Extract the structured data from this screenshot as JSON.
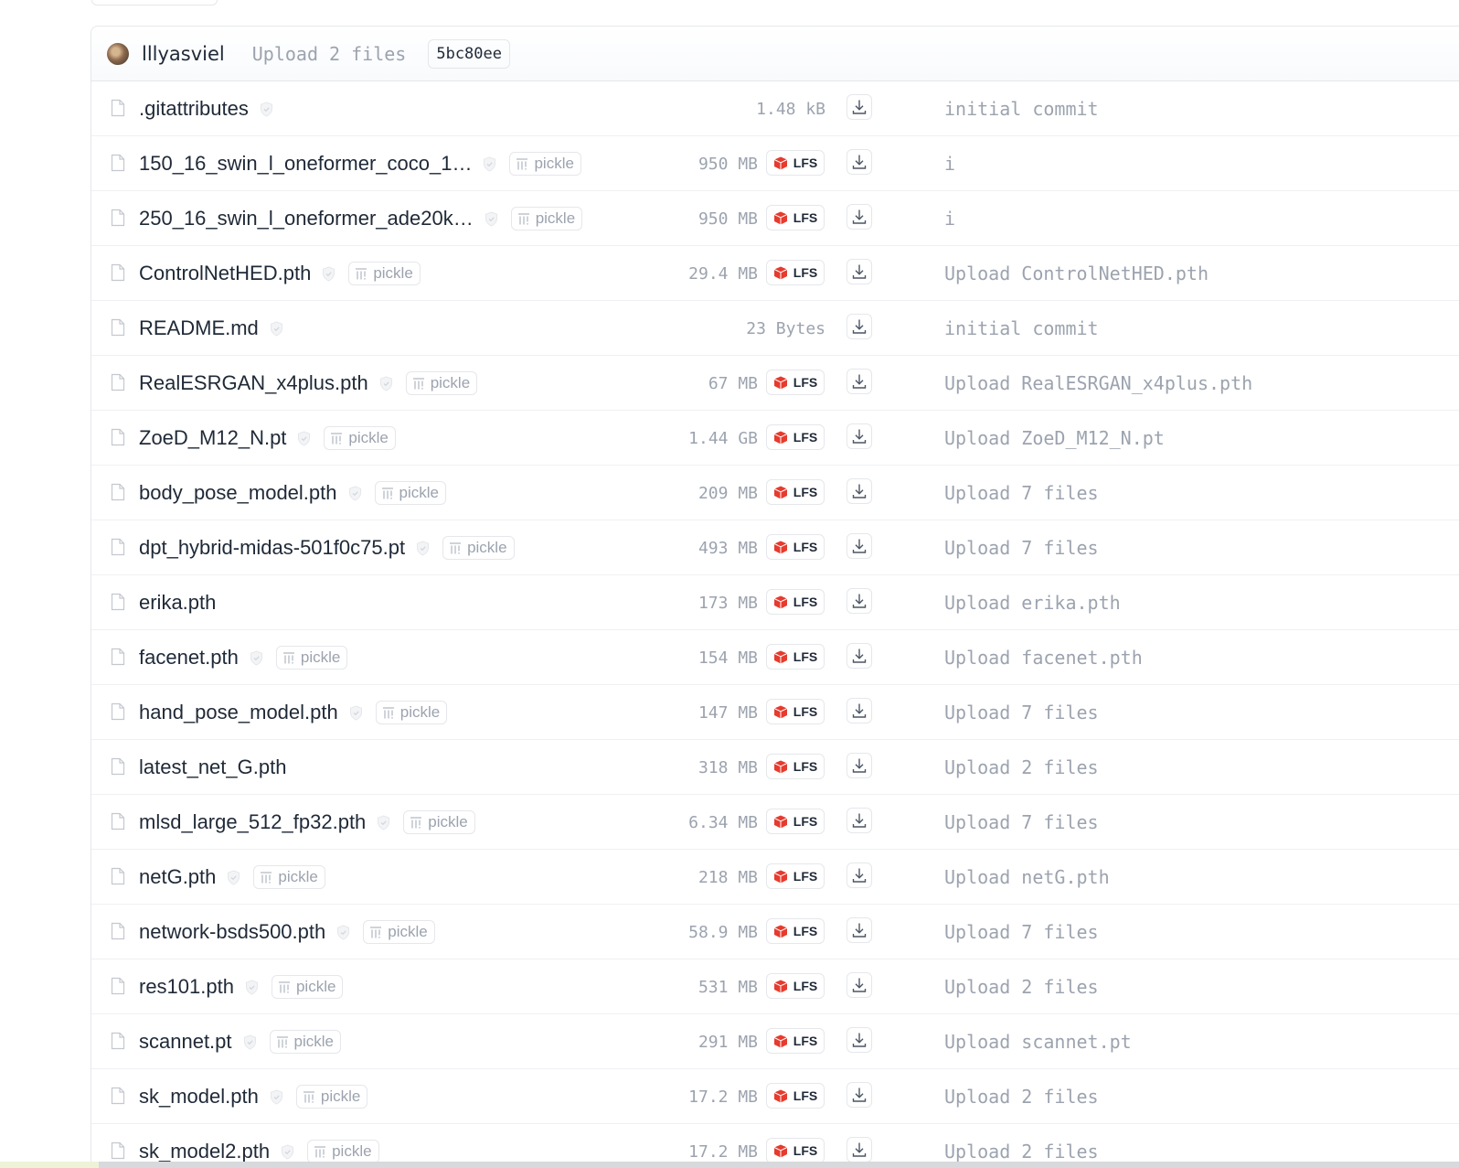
{
  "commit": {
    "author": "lllyasviel",
    "message": "Upload 2 files",
    "hash": "5bc80ee"
  },
  "labels": {
    "pickle": "pickle",
    "lfs": "LFS"
  },
  "files": [
    {
      "name": ".gitattributes",
      "pickle": false,
      "size": "1.48 kB",
      "lfs": false,
      "msg": "initial commit"
    },
    {
      "name": "150_16_swin_l_oneformer_coco_1…",
      "pickle": true,
      "size": "950 MB",
      "lfs": true,
      "msg": "i"
    },
    {
      "name": "250_16_swin_l_oneformer_ade20k…",
      "pickle": true,
      "size": "950 MB",
      "lfs": true,
      "msg": "i"
    },
    {
      "name": "ControlNetHED.pth",
      "pickle": true,
      "size": "29.4 MB",
      "lfs": true,
      "msg": "Upload ControlNetHED.pth"
    },
    {
      "name": "README.md",
      "pickle": false,
      "size": "23 Bytes",
      "lfs": false,
      "msg": "initial commit"
    },
    {
      "name": "RealESRGAN_x4plus.pth",
      "pickle": true,
      "size": "67 MB",
      "lfs": true,
      "msg": "Upload RealESRGAN_x4plus.pth"
    },
    {
      "name": "ZoeD_M12_N.pt",
      "pickle": true,
      "size": "1.44 GB",
      "lfs": true,
      "msg": "Upload ZoeD_M12_N.pt"
    },
    {
      "name": "body_pose_model.pth",
      "pickle": true,
      "size": "209 MB",
      "lfs": true,
      "msg": "Upload 7 files"
    },
    {
      "name": "dpt_hybrid-midas-501f0c75.pt",
      "pickle": true,
      "size": "493 MB",
      "lfs": true,
      "msg": "Upload 7 files"
    },
    {
      "name": "erika.pth",
      "pickle": false,
      "safe": false,
      "size": "173 MB",
      "lfs": true,
      "msg": "Upload erika.pth"
    },
    {
      "name": "facenet.pth",
      "pickle": true,
      "size": "154 MB",
      "lfs": true,
      "msg": "Upload facenet.pth"
    },
    {
      "name": "hand_pose_model.pth",
      "pickle": true,
      "size": "147 MB",
      "lfs": true,
      "msg": "Upload 7 files"
    },
    {
      "name": "latest_net_G.pth",
      "pickle": false,
      "safe": false,
      "size": "318 MB",
      "lfs": true,
      "msg": "Upload 2 files"
    },
    {
      "name": "mlsd_large_512_fp32.pth",
      "pickle": true,
      "size": "6.34 MB",
      "lfs": true,
      "msg": "Upload 7 files"
    },
    {
      "name": "netG.pth",
      "pickle": true,
      "size": "218 MB",
      "lfs": true,
      "msg": "Upload netG.pth"
    },
    {
      "name": "network-bsds500.pth",
      "pickle": true,
      "size": "58.9 MB",
      "lfs": true,
      "msg": "Upload 7 files"
    },
    {
      "name": "res101.pth",
      "pickle": true,
      "size": "531 MB",
      "lfs": true,
      "msg": "Upload 2 files"
    },
    {
      "name": "scannet.pt",
      "pickle": true,
      "size": "291 MB",
      "lfs": true,
      "msg": "Upload scannet.pt"
    },
    {
      "name": "sk_model.pth",
      "pickle": true,
      "size": "17.2 MB",
      "lfs": true,
      "msg": "Upload 2 files"
    },
    {
      "name": "sk_model2.pth",
      "pickle": true,
      "size": "17.2 MB",
      "lfs": true,
      "msg": "Upload 2 files"
    }
  ]
}
